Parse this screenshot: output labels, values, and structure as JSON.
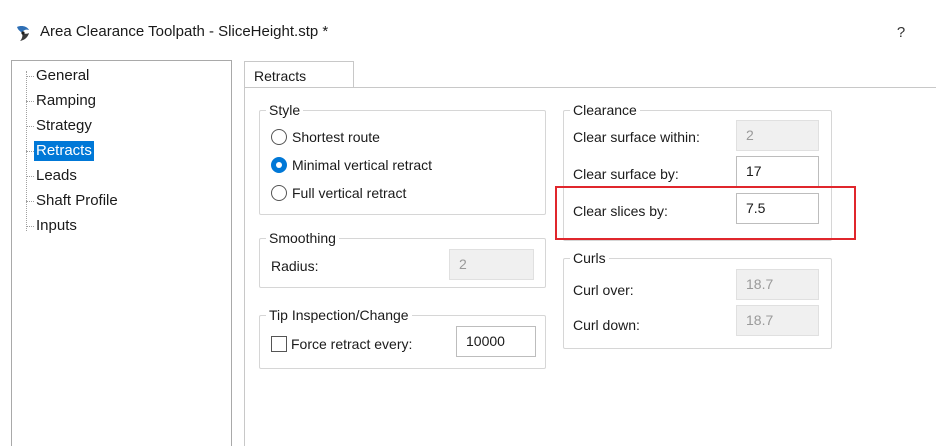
{
  "window": {
    "title": "Area Clearance Toolpath - SliceHeight.stp *",
    "help_label": "?"
  },
  "nav": {
    "items": [
      {
        "label": "General"
      },
      {
        "label": "Ramping"
      },
      {
        "label": "Strategy"
      },
      {
        "label": "Retracts",
        "selected": true
      },
      {
        "label": "Leads"
      },
      {
        "label": "Shaft Profile"
      },
      {
        "label": "Inputs"
      }
    ]
  },
  "tab": {
    "label": "Retracts"
  },
  "style": {
    "title": "Style",
    "options": [
      {
        "label": "Shortest route",
        "checked": false
      },
      {
        "label": "Minimal vertical retract",
        "checked": true
      },
      {
        "label": "Full vertical retract",
        "checked": false
      }
    ]
  },
  "clearance": {
    "title": "Clearance",
    "surface_within_label": "Clear surface within:",
    "surface_within_value": "2",
    "surface_by_label": "Clear surface by:",
    "surface_by_value": "17",
    "slices_by_label": "Clear slices by:",
    "slices_by_value": "7.5"
  },
  "smoothing": {
    "title": "Smoothing",
    "radius_label": "Radius:",
    "radius_value": "2"
  },
  "curls": {
    "title": "Curls",
    "over_label": "Curl over:",
    "over_value": "18.7",
    "down_label": "Curl down:",
    "down_value": "18.7"
  },
  "tip": {
    "title": "Tip Inspection/Change",
    "force_label": "Force retract every:",
    "force_checked": false,
    "force_value": "10000"
  },
  "colors": {
    "accent": "#0078d7",
    "highlight": "#e0262c"
  },
  "icons": {
    "app": "toolpath-app-icon",
    "help": "help-icon"
  }
}
